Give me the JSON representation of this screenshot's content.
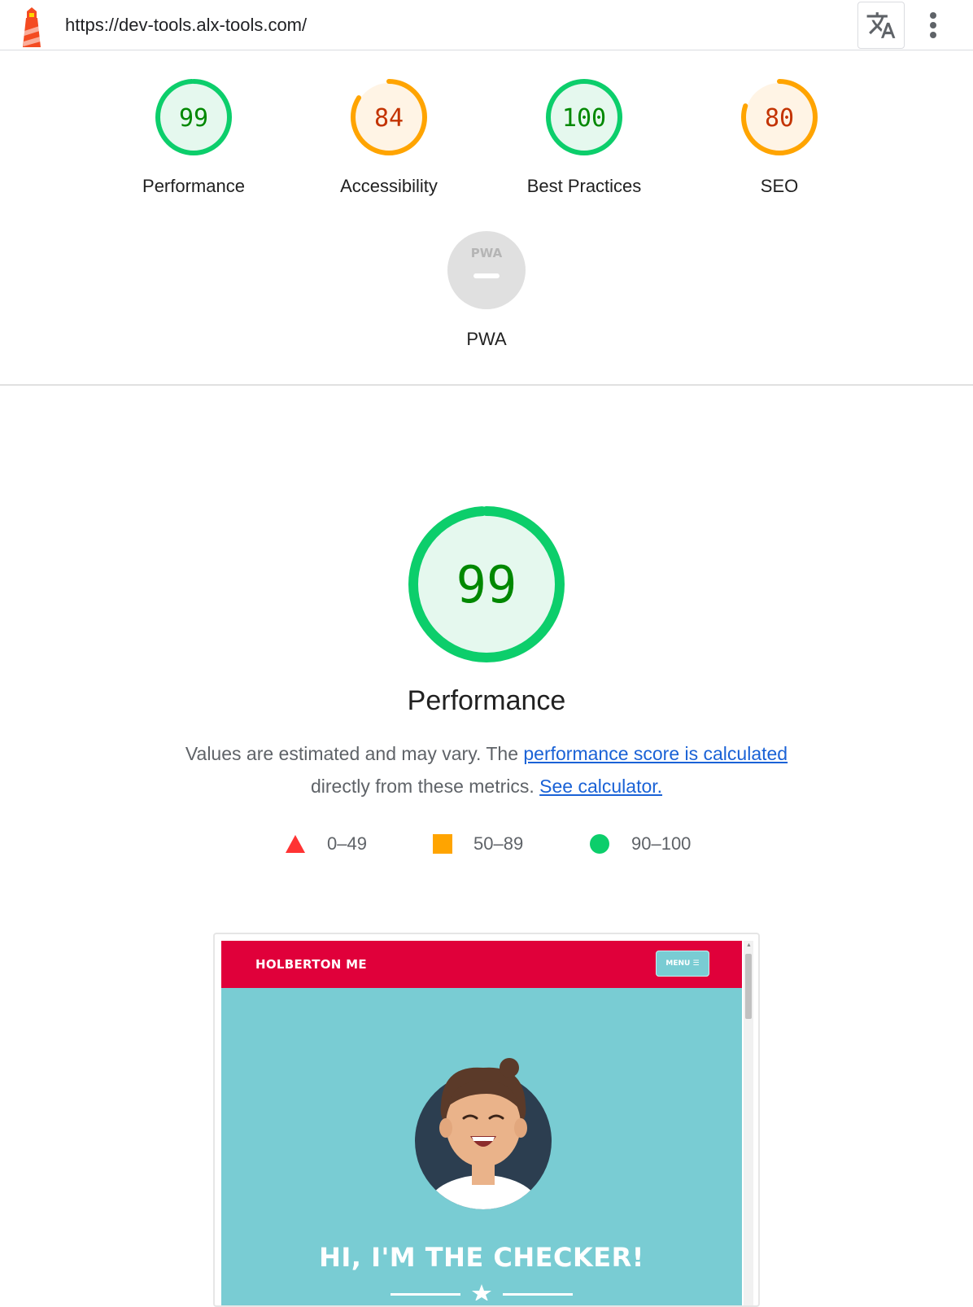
{
  "topbar": {
    "url": "https://dev-tools.alx-tools.com/",
    "translate_icon": "translate-icon",
    "menu_icon": "kebab-menu-icon"
  },
  "scores": [
    {
      "label": "Performance",
      "score": 99,
      "rating": "pass"
    },
    {
      "label": "Accessibility",
      "score": 84,
      "rating": "average"
    },
    {
      "label": "Best Practices",
      "score": 100,
      "rating": "pass"
    },
    {
      "label": "SEO",
      "score": 80,
      "rating": "average"
    }
  ],
  "pwa": {
    "label": "PWA",
    "badge": "PWA",
    "score": "—"
  },
  "performance": {
    "score": "99",
    "title": "Performance",
    "desc_before": "Values are estimated and may vary. The ",
    "desc_link1": "performance score is calculated",
    "desc_middle": " directly from these metrics. ",
    "desc_link2": "See calculator."
  },
  "legend": [
    {
      "range": "0–49",
      "shape": "triangle",
      "color": "#ff3333"
    },
    {
      "range": "50–89",
      "shape": "square",
      "color": "#ffa400"
    },
    {
      "range": "90–100",
      "shape": "circle",
      "color": "#0cce6b"
    }
  ],
  "colors": {
    "pass_ring": "#0cce6b",
    "pass_fill": "#e5f8ee",
    "pass_text": "#008800",
    "average_ring": "#ffa400",
    "average_fill": "#fff4e5",
    "average_text": "#c33300",
    "pwa_fill": "#e0e0e0"
  },
  "preview": {
    "brand": "HOLBERTON ME",
    "menu": "MENU ☰",
    "headline": "HI, I'M THE CHECKER!"
  }
}
